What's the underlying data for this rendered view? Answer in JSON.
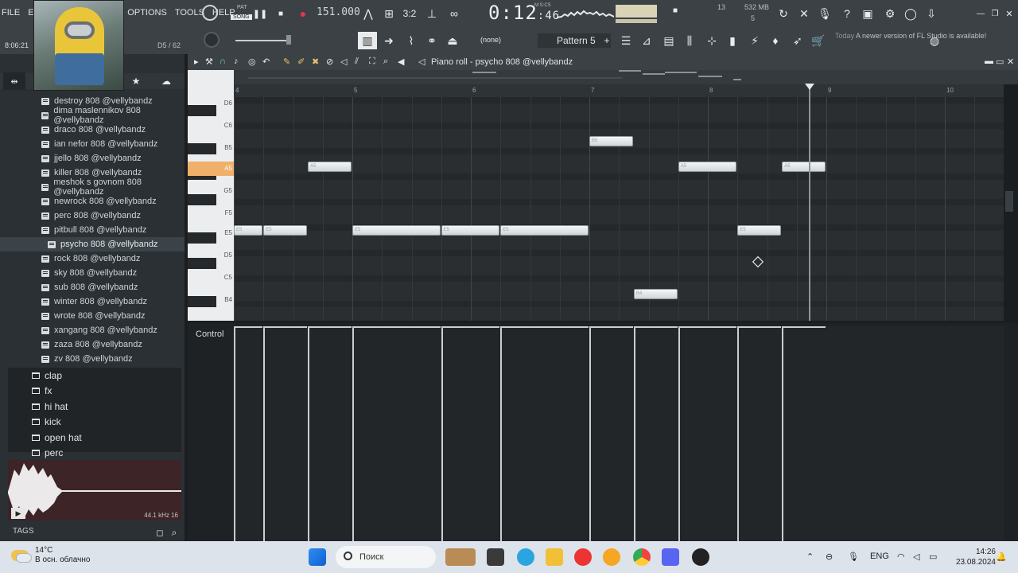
{
  "menu": [
    "FILE",
    "EDIT",
    "OPTIONS",
    "TOOLS",
    "HELP"
  ],
  "topbar": {
    "pat_label": "PAT",
    "song_label": "SONG",
    "tempo": "151.000",
    "time_main": "0:12",
    "time_sub": "46",
    "time_caption": "M:S:CS",
    "pattern": "Pattern 5",
    "snap": "(none)",
    "mem": "532 MB",
    "voices": "13",
    "cpu": "5",
    "step_display": "D5 / 62",
    "notice_label": "Today",
    "notice": "A newer version of FL Studio is available!",
    "clock": "8:06:21"
  },
  "browser": {
    "items": [
      "destroy 808 @vellybandz",
      "dima maslennikov 808 @vellybandz",
      "draco 808 @vellybandz",
      "ian nefor 808 @vellybandz",
      "jjello 808 @vellybandz",
      "killer 808 @vellybandz",
      "meshok s govnom 808 @vellybandz",
      "newrock 808 @vellybandz",
      "perc 808 @vellybandz",
      "pitbull 808 @vellybandz",
      "psycho 808 @vellybandz",
      "rock 808 @vellybandz",
      "sky 808 @vellybandz",
      "sub 808 @vellybandz",
      "winter 808 @vellybandz",
      "wrote 808 @vellybandz",
      "xangang 808 @vellybandz",
      "zaza 808 @vellybandz",
      "zv 808 @vellybandz"
    ],
    "selected_index": 10,
    "folders": [
      "clap",
      "fx",
      "hi hat",
      "kick",
      "open hat",
      "perc"
    ],
    "preview_info": "44.1 kHz 16",
    "tags_label": "TAGS"
  },
  "piano_roll": {
    "title": "Piano roll - psycho 808 @vellybandz",
    "keys": [
      "D6",
      "C6",
      "B5",
      "A5",
      "G5",
      "F5",
      "E5",
      "D5",
      "C5",
      "B4"
    ],
    "active_key": "A5",
    "ruler": [
      "4",
      "5",
      "6",
      "7",
      "8",
      "9",
      "10"
    ],
    "control_label": "Control",
    "notes": [
      {
        "pitch": "E5",
        "start": 4.0,
        "length": 0.25
      },
      {
        "pitch": "E5",
        "start": 4.25,
        "length": 0.375
      },
      {
        "pitch": "A5",
        "start": 4.625,
        "length": 0.375
      },
      {
        "pitch": "E5",
        "start": 5.0,
        "length": 0.75
      },
      {
        "pitch": "E5",
        "start": 5.75,
        "length": 0.5
      },
      {
        "pitch": "E5",
        "start": 6.25,
        "length": 0.75
      },
      {
        "pitch": "B5",
        "start": 7.0,
        "length": 0.375
      },
      {
        "pitch": "B4",
        "start": 7.375,
        "length": 0.375
      },
      {
        "pitch": "A5",
        "start": 7.75,
        "length": 0.5
      },
      {
        "pitch": "E5",
        "start": 8.25,
        "length": 0.375
      },
      {
        "pitch": "A5",
        "start": 8.625,
        "length": 0.375
      }
    ]
  },
  "taskbar": {
    "temp": "14°C",
    "weather": "В осн. облачно",
    "search": "Поиск",
    "lang": "ENG",
    "time": "14:26",
    "date": "23.08.2024"
  }
}
